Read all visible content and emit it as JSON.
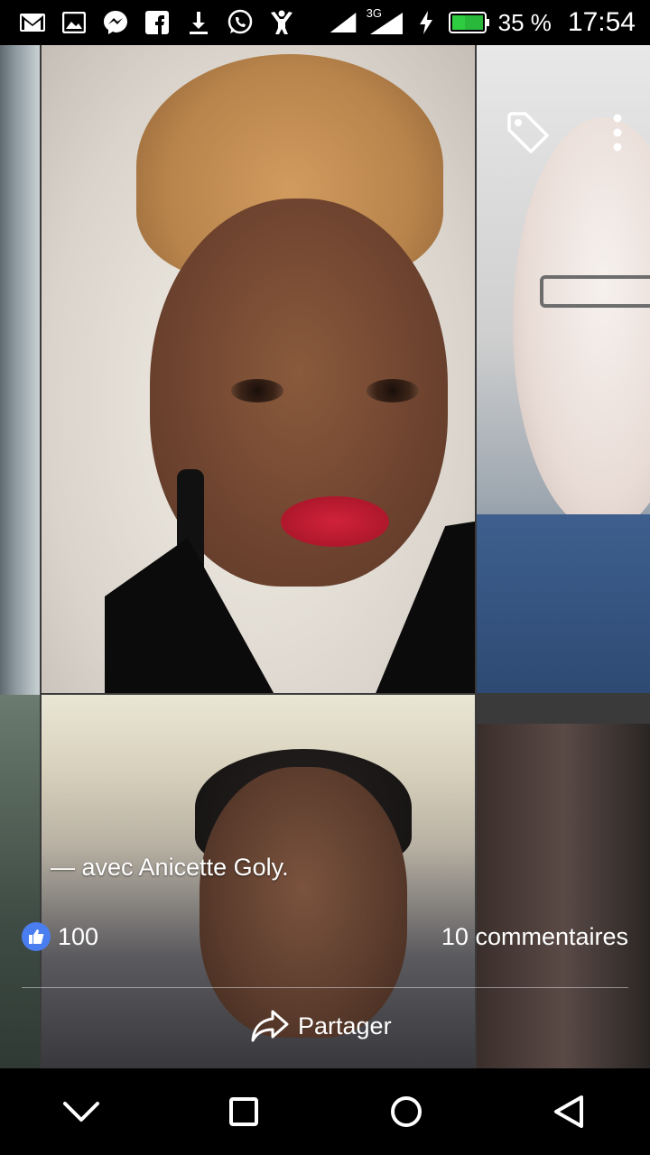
{
  "status_bar": {
    "battery_percent": "35 %",
    "network": "3G",
    "time": "17:54",
    "left_icons": [
      "gmail-icon",
      "gallery-icon",
      "messenger-icon",
      "facebook-icon",
      "download-icon",
      "whatsapp-icon",
      "fitness-icon"
    ]
  },
  "photo": {
    "caption": "— avec Anicette Goly.",
    "likes_count": "100",
    "comments": "10 commentaires",
    "share_label": "Partager"
  },
  "colors": {
    "like_blue": "#4a7ef0",
    "battery_green": "#2ecc40",
    "lip_red": "#c41e32"
  }
}
